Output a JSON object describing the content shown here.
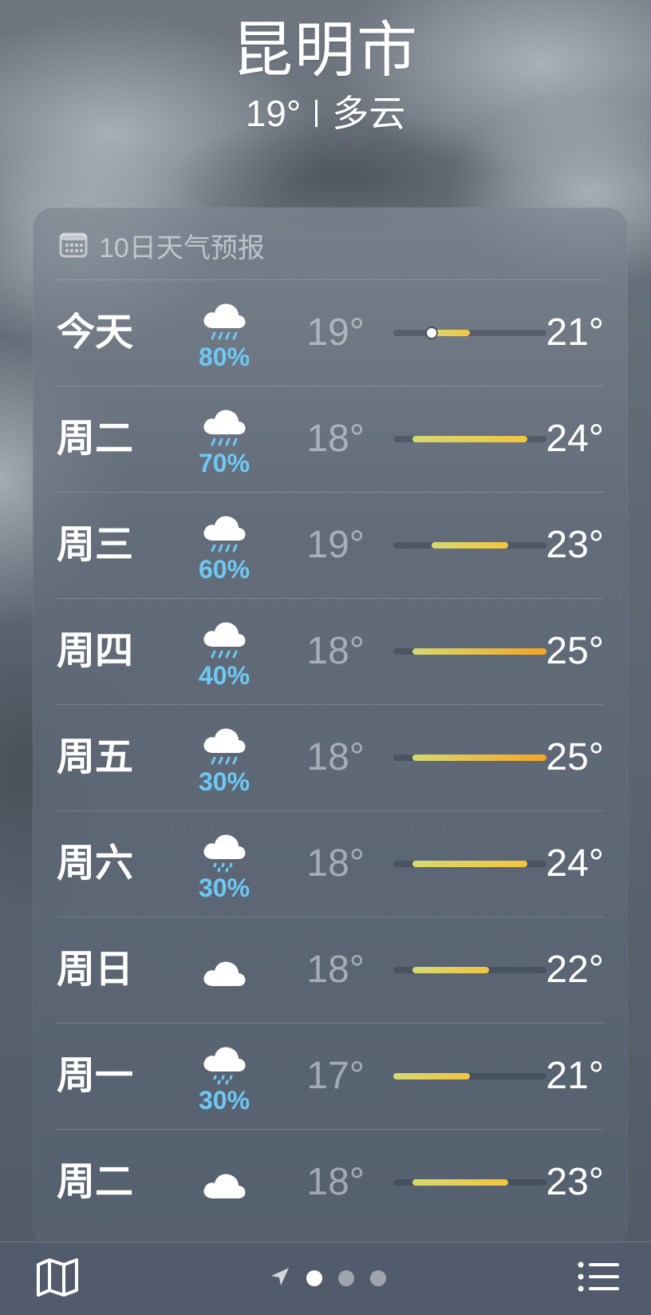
{
  "header": {
    "city": "昆明市",
    "temperature": "19°",
    "condition": "多云"
  },
  "forecast": {
    "title": "10日天气预报",
    "title_icon": "calendar-icon",
    "scale_min": 17,
    "scale_max": 25,
    "current_temp": 19,
    "days": [
      {
        "day": "今天",
        "icon": "cloud-rain-icon",
        "precip": "80%",
        "low": "19°",
        "high": "21°",
        "low_val": 19,
        "high_val": 21,
        "current": true
      },
      {
        "day": "周二",
        "icon": "cloud-rain-icon",
        "precip": "70%",
        "low": "18°",
        "high": "24°",
        "low_val": 18,
        "high_val": 24
      },
      {
        "day": "周三",
        "icon": "cloud-rain-icon",
        "precip": "60%",
        "low": "19°",
        "high": "23°",
        "low_val": 19,
        "high_val": 23
      },
      {
        "day": "周四",
        "icon": "cloud-rain-icon",
        "precip": "40%",
        "low": "18°",
        "high": "25°",
        "low_val": 18,
        "high_val": 25
      },
      {
        "day": "周五",
        "icon": "cloud-rain-icon",
        "precip": "30%",
        "low": "18°",
        "high": "25°",
        "low_val": 18,
        "high_val": 25
      },
      {
        "day": "周六",
        "icon": "cloud-drizzle-icon",
        "precip": "30%",
        "low": "18°",
        "high": "24°",
        "low_val": 18,
        "high_val": 24
      },
      {
        "day": "周日",
        "icon": "cloud-icon",
        "precip": "",
        "low": "18°",
        "high": "22°",
        "low_val": 18,
        "high_val": 22
      },
      {
        "day": "周一",
        "icon": "cloud-drizzle-icon",
        "precip": "30%",
        "low": "17°",
        "high": "21°",
        "low_val": 17,
        "high_val": 21
      },
      {
        "day": "周二",
        "icon": "cloud-icon",
        "precip": "",
        "low": "18°",
        "high": "23°",
        "low_val": 18,
        "high_val": 23
      }
    ]
  },
  "toolbar": {
    "map_icon": "map-icon",
    "location_icon": "location-arrow-icon",
    "pages": 3,
    "active_page": 0,
    "list_icon": "list-icon"
  },
  "colors": {
    "precip_text": "#6ec8f5",
    "bar_cool": "#d6d872",
    "bar_mid": "#f2c53d",
    "bar_warm": "#f5a623"
  }
}
